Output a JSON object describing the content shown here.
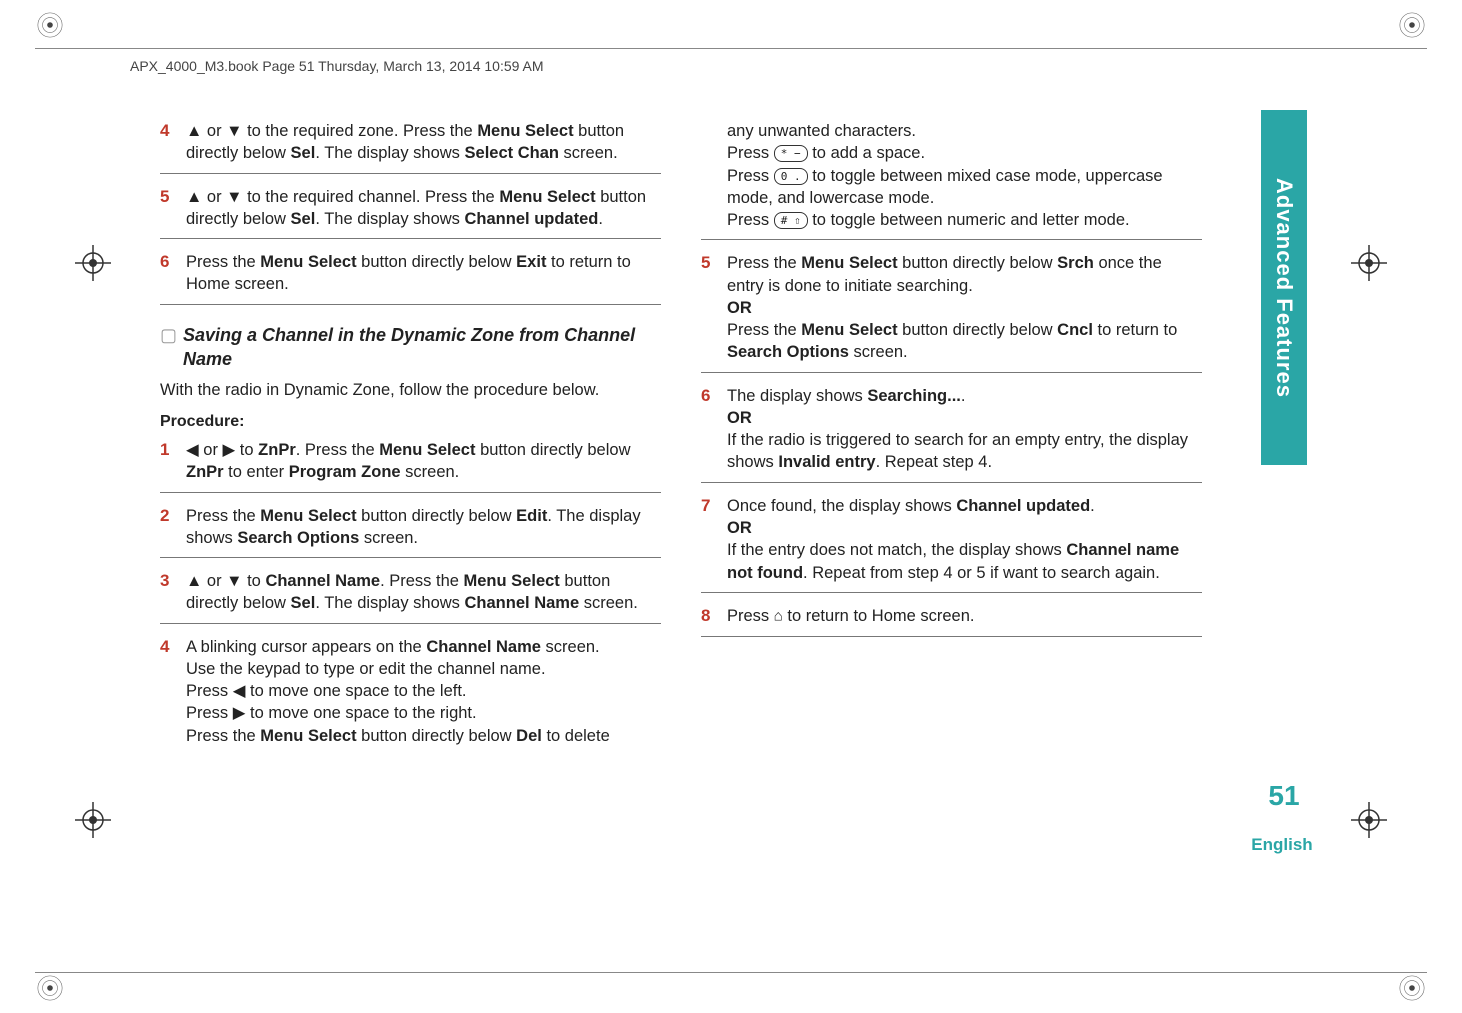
{
  "header": "APX_4000_M3.book  Page 51  Thursday, March 13, 2014  10:59 AM",
  "sidetab": "Advanced Features",
  "pagenum": "51",
  "lang": "English",
  "left": {
    "step4": "▲ or ▼ to the required zone. Press the <b>Menu Select</b> button directly below <span class=\"ui\">Sel</span>. The display shows <b>Select Chan</b> screen.",
    "step5": "▲ or ▼ to the required channel. Press the <b>Menu Select</b> button directly below <span class=\"ui\">Sel</span>. The display shows <span class=\"ui\">Channel updated</span>.",
    "step6": "Press the <b>Menu Select</b> button directly below <span class=\"ui\">Exit</span> to return to Home screen.",
    "sectionTitle": "Saving a Channel in the Dynamic Zone from Channel Name",
    "intro": "With the radio in Dynamic Zone, follow the procedure below.",
    "procedure": "Procedure:",
    "s1": "◀ or ▶ to <span class=\"ui\">ZnPr</span>. Press the <b>Menu Select</b> button directly below <span class=\"ui\">ZnPr</span> to enter <b>Program Zone</b> screen.",
    "s2": "Press the <b>Menu Select</b> button directly below <span class=\"ui\">Edit</span>. The display shows <b>Search Options</b> screen.",
    "s3": "▲ or ▼ to <span class=\"ui\">Channel Name</span>. Press the <b>Menu Select</b> button directly below <span class=\"ui\">Sel</span>. The display shows <b>Channel Name</b> screen.",
    "s4a": "A blinking cursor appears on the <span class=\"ui\">Channel Name</span> screen.",
    "s4b": "Use the keypad to type or edit the channel name.",
    "s4c": "Press ◀ to move one space to the left.",
    "s4d": "Press ▶ to move one space to the right.",
    "s4e": "Press the <b>Menu Select</b> button directly below <span class=\"ui\">Del</span> to delete"
  },
  "right": {
    "r4a": "any unwanted characters.",
    "r4b": "Press <span class=\"keycap\">* −</span> to add a space.",
    "r4c": "Press <span class=\"keycap\">0 .</span> to toggle between mixed case mode, uppercase mode, and lowercase mode.",
    "r4d": "Press <span class=\"keycap\"># ⇧</span> to toggle between numeric and letter mode.",
    "r5": "Press the <b>Menu Select</b> button directly below <span class=\"ui\">Srch</span> once the entry is done to initiate searching.<br><b>OR</b><br>Press the <b>Menu Select</b> button directly below <span class=\"ui\">Cncl</span> to return to <b>Search Options</b> screen.",
    "r6": "The display shows <span class=\"ui\">Searching...</span>.<br><b>OR</b><br>If the radio is triggered to search for an empty entry, the display shows <span class=\"ui\">Invalid entry</span>. Repeat step 4.",
    "r7": "Once found, the display shows <span class=\"ui\">Channel updated</span>.<br><b>OR</b><br>If the entry does not match, the display shows <span class=\"ui\">Channel name not found</span>. Repeat from step 4 or 5 if want to search again.",
    "r8": "Press <span class=\"home-icon\">⌂</span> to return to Home screen."
  }
}
